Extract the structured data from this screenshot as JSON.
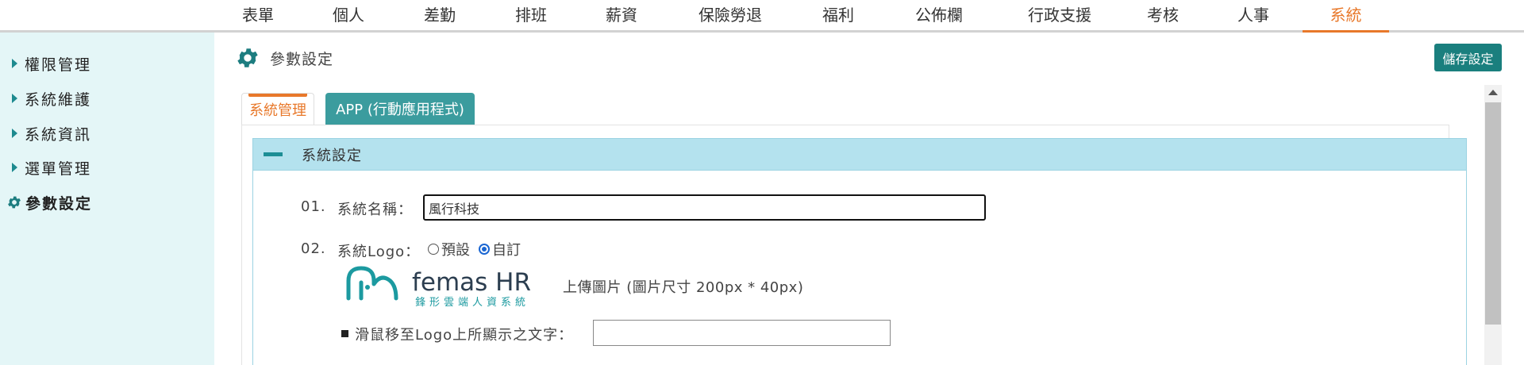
{
  "topnav": {
    "items": [
      {
        "label": "表單"
      },
      {
        "label": "個人"
      },
      {
        "label": "差勤"
      },
      {
        "label": "排班"
      },
      {
        "label": "薪資"
      },
      {
        "label": "保險勞退"
      },
      {
        "label": "福利"
      },
      {
        "label": "公佈欄"
      },
      {
        "label": "行政支援"
      },
      {
        "label": "考核"
      },
      {
        "label": "人事"
      },
      {
        "label": "系統"
      }
    ],
    "active": "系統",
    "accent_color": "#e8782a"
  },
  "sidebar": {
    "items": [
      {
        "label": "權限管理",
        "icon": "caret-right-icon"
      },
      {
        "label": "系統維護",
        "icon": "caret-right-icon"
      },
      {
        "label": "系統資訊",
        "icon": "caret-right-icon"
      },
      {
        "label": "選單管理",
        "icon": "caret-right-icon"
      },
      {
        "label": "參數設定",
        "icon": "gear-icon"
      }
    ],
    "background": "#e4f6f7"
  },
  "page": {
    "title": "參數設定",
    "icon": "gear-icon",
    "save_label": "儲存設定",
    "save_color": "#1a7f7e"
  },
  "tabs": [
    {
      "label": "系統管理",
      "active": true
    },
    {
      "label": "APP (行動應用程式)",
      "active": false
    }
  ],
  "section": {
    "title": "系統設定",
    "toggle_icon": "minus-icon",
    "header_color": "#b4e2ee"
  },
  "form": {
    "row1": {
      "number": "01.",
      "label": "系統名稱：",
      "value": "風行科技"
    },
    "row2": {
      "number": "02.",
      "label": "系統Logo：",
      "options": [
        {
          "label": "預設",
          "checked": false
        },
        {
          "label": "自訂",
          "checked": true
        }
      ],
      "logo": {
        "brand": "femas HR",
        "tagline": "鋒形雲端人資系統"
      },
      "upload_note": "上傳圖片 (圖片尺寸 200px * 40px)",
      "hover_label": "滑鼠移至Logo上所顯示之文字：",
      "hover_value": ""
    }
  }
}
